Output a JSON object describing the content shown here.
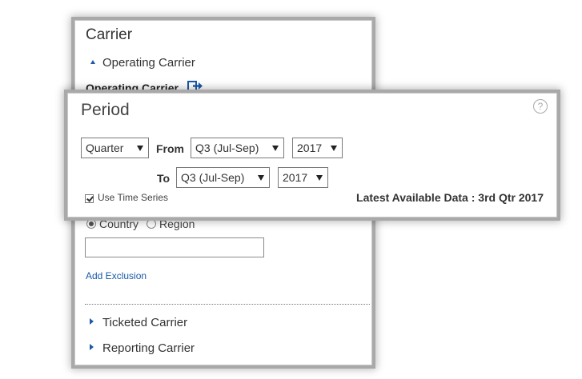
{
  "carrier": {
    "title": "Carrier",
    "operating_toggle_label": "Operating Carrier",
    "operating_field_label": "Operating Carrier",
    "location_options": [
      "Country",
      "Region"
    ],
    "location_selected": "Country",
    "country_input_value": "",
    "add_exclusion_label": "Add Exclusion",
    "ticketed_label": "Ticketed Carrier",
    "reporting_label": "Reporting Carrier"
  },
  "period": {
    "title": "Period",
    "help_glyph": "?",
    "granularity_value": "Quarter",
    "from_label": "From",
    "from_quarter": "Q3 (Jul-Sep)",
    "from_year": "2017",
    "to_label": "To",
    "to_quarter": "Q3 (Jul-Sep)",
    "to_year": "2017",
    "time_series_label": "Use Time Series",
    "time_series_checked": true,
    "latest_data_text": "Latest Available Data : 3rd Qtr 2017"
  },
  "icons": {
    "operating_toggle": "triangle-up-icon",
    "export": "export-icon",
    "help": "help-icon",
    "ticketed_toggle": "triangle-right-icon",
    "reporting_toggle": "triangle-right-icon"
  },
  "colors": {
    "accent": "#1a5aa8",
    "panel_border": "#a9a9a9"
  }
}
